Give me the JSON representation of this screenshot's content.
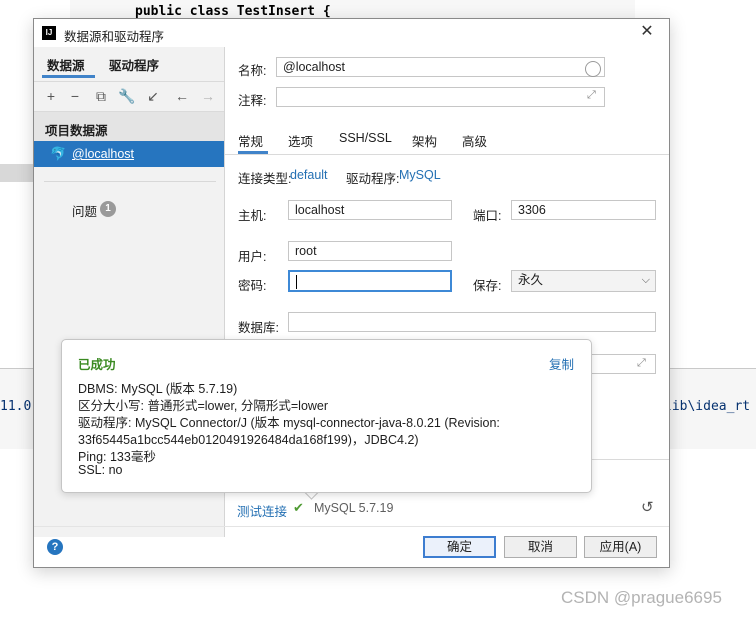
{
  "ide": {
    "code_line": "public class TestInsert {",
    "left_fragment": "11.0",
    "right_fragment": "lib\\idea_rt"
  },
  "dialog": {
    "logo": "IJ",
    "title": "数据源和驱动程序",
    "close_glyph": "✕"
  },
  "left_panel": {
    "tabs": [
      "数据源",
      "驱动程序"
    ],
    "toolbar_glyphs": [
      "+",
      "−",
      "⧉",
      "🔧",
      "↙",
      "←",
      "→"
    ],
    "section_header": "项目数据源",
    "datasource": "@localhost",
    "problems_label": "问题",
    "problems_count": "1"
  },
  "form": {
    "name_label": "名称:",
    "name_value": "@localhost",
    "comment_label": "注释:",
    "comment_value": "",
    "tabs": [
      "常规",
      "选项",
      "SSH/SSL",
      "架构",
      "高级"
    ],
    "conn_type_label": "连接类型:",
    "conn_type_value": "default",
    "driver_label": "驱动程序:",
    "driver_value": "MySQL",
    "host_label": "主机:",
    "host_value": "localhost",
    "port_label": "端口:",
    "port_value": "3306",
    "user_label": "用户:",
    "user_value": "root",
    "password_label": "密码:",
    "password_value": "",
    "save_label": "保存:",
    "save_value": "永久",
    "database_label": "数据库:",
    "database_value": ""
  },
  "test": {
    "link": "测试连接",
    "check": "✔",
    "version": "MySQL 5.7.19",
    "undo_glyph": "↺"
  },
  "buttons": {
    "help": "?",
    "ok": "确定",
    "cancel": "取消",
    "apply": "应用(A)"
  },
  "popup": {
    "title": "已成功",
    "copy": "复制",
    "lines": [
      "DBMS: MySQL (版本 5.7.19)",
      "区分大小写: 普通形式=lower, 分隔形式=lower",
      "驱动程序: MySQL Connector/J (版本 mysql-connector-java-8.0.21 (Revision:",
      "33f65445a1bcc544eb0120491926484da168f199)，JDBC4.2)",
      "Ping: 133毫秒",
      "SSL: no"
    ]
  },
  "watermark": "CSDN @prague6695"
}
